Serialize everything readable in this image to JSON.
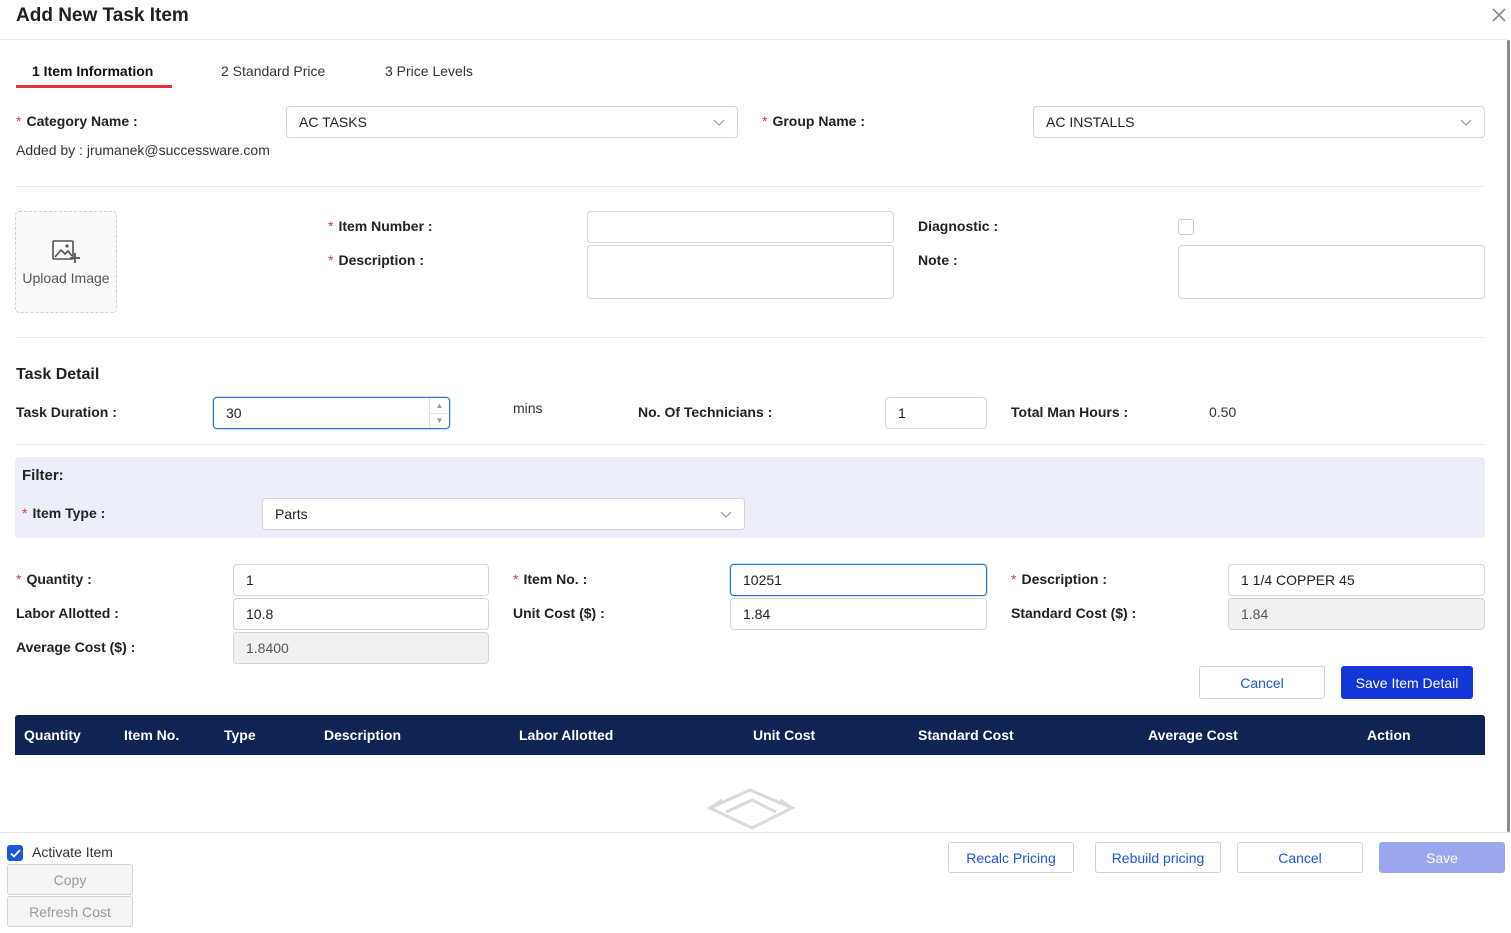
{
  "dialog": {
    "title": "Add New Task Item"
  },
  "tabs": [
    {
      "label": "1 Item Information"
    },
    {
      "label": "2 Standard Price"
    },
    {
      "label": "3 Price Levels"
    }
  ],
  "category": {
    "label": "Category Name",
    "value": "AC TASKS"
  },
  "group": {
    "label": "Group Name",
    "value": "AC INSTALLS"
  },
  "added_by": "Added by : jrumanek@successware.com",
  "upload": {
    "label": "Upload Image"
  },
  "item_number": {
    "label": "Item Number",
    "value": ""
  },
  "description": {
    "label": "Description",
    "value": ""
  },
  "diagnostic": {
    "label": "Diagnostic",
    "checked": false
  },
  "note": {
    "label": "Note",
    "value": ""
  },
  "task_detail": {
    "heading": "Task Detail",
    "duration_label": "Task Duration",
    "duration_value": "30",
    "duration_unit": "mins",
    "techs_label": "No. Of Technicians",
    "techs_value": "1",
    "man_hours_label": "Total Man Hours",
    "man_hours_value": "0.50"
  },
  "filter": {
    "heading": "Filter:",
    "item_type_label": "Item Type",
    "item_type_value": "Parts"
  },
  "item_detail": {
    "quantity_label": "Quantity",
    "quantity_value": "1",
    "item_no_label": "Item No.",
    "item_no_value": "10251",
    "desc_label": "Description",
    "desc_value": "1 1/4 COPPER 45",
    "labor_label": "Labor Allotted",
    "labor_value": "10.8",
    "unit_cost_label": "Unit Cost ($)",
    "unit_cost_value": "1.84",
    "std_cost_label": "Standard Cost ($)",
    "std_cost_value": "1.84",
    "avg_cost_label": "Average Cost ($)",
    "avg_cost_value": "1.8400",
    "cancel_label": "Cancel",
    "save_label": "Save Item Detail"
  },
  "table": {
    "columns": [
      "Quantity",
      "Item No.",
      "Type",
      "Description",
      "Labor Allotted",
      "Unit Cost",
      "Standard Cost",
      "Average Cost",
      "Action"
    ],
    "rows": []
  },
  "footer": {
    "activate_label": "Activate Item",
    "activate_checked": true,
    "copy_label": "Copy",
    "refresh_label": "Refresh Cost",
    "recalc_label": "Recalc Pricing",
    "rebuild_label": "Rebuild pricing",
    "cancel_label": "Cancel",
    "save_label": "Save"
  },
  "colors": {
    "accent_tab": "#e0353b",
    "header_bg": "#0f2453",
    "primary": "#1436d8",
    "filter_bg": "#eceff9"
  }
}
